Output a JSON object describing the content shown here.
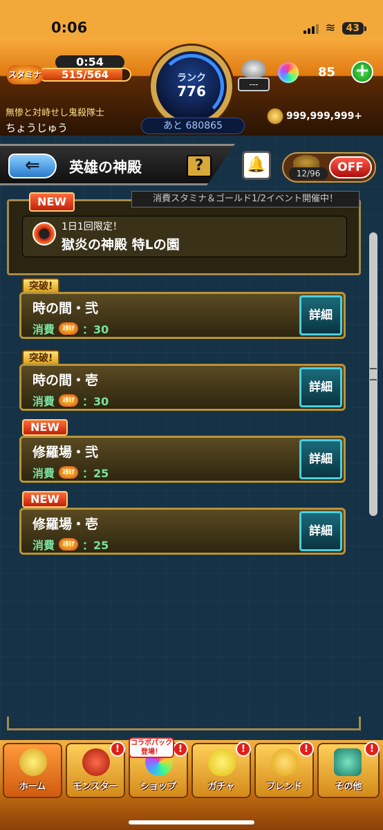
{
  "status_bar": {
    "time": "0:06",
    "battery": "43"
  },
  "header": {
    "stamina_label": "スタミナ",
    "stamina_timer": "0:54",
    "stamina_value": "515/564",
    "stamina_fraction": 0.913,
    "rank_label": "ランク",
    "rank_value": "776",
    "rank_next": "あと 680865",
    "item_label": "---",
    "orb_count": "85",
    "plus_label": "+",
    "player_title": "無惨と対峙せし鬼殺隊士",
    "player_name": "ちょうじゅう",
    "gold": "999,999,999+"
  },
  "toolbar": {
    "back_label": "⇐",
    "title": "英雄の神殿",
    "help_label": "?",
    "bell_icon": "bell-icon",
    "toggle_count": "12/96",
    "toggle_label": "OFF"
  },
  "event": {
    "new_label": "NEW",
    "notice": "消費スタミナ＆ゴールド1/2イベント開催中！",
    "sub": "1日1回限定！",
    "name": "獄炎の神殿 特Lの園"
  },
  "quests": [
    {
      "badge": "突破!",
      "name": "時の間・弐",
      "cost_label": "消費",
      "stamina_label": "ｽﾀﾐﾅ",
      "cost": "：30",
      "detail_label": "詳細"
    },
    {
      "badge": "突破!",
      "name": "時の間・壱",
      "cost_label": "消費",
      "stamina_label": "ｽﾀﾐﾅ",
      "cost": "：30",
      "detail_label": "詳細"
    },
    {
      "badge": "NEW",
      "name": "修羅場・弐",
      "cost_label": "消費",
      "stamina_label": "ｽﾀﾐﾅ",
      "cost": "：25",
      "detail_label": "詳細"
    },
    {
      "badge": "NEW",
      "name": "修羅場・壱",
      "cost_label": "消費",
      "stamina_label": "ｽﾀﾐﾅ",
      "cost": "：25",
      "detail_label": "詳細"
    }
  ],
  "tabs": [
    {
      "label": "ホーム",
      "alert": ""
    },
    {
      "label": "モンスター",
      "alert": "!"
    },
    {
      "label": "ショップ",
      "alert": "!"
    },
    {
      "label": "ガチャ",
      "alert": "!"
    },
    {
      "label": "フレンド",
      "alert": "!"
    },
    {
      "label": "その他",
      "alert": "!"
    }
  ],
  "collab_badge": "コラボパック登場！",
  "colors": {
    "accent": "#f3a93a",
    "panel": "#163246",
    "detail": "#4ad0e0",
    "new_badge": "#c0200a"
  }
}
